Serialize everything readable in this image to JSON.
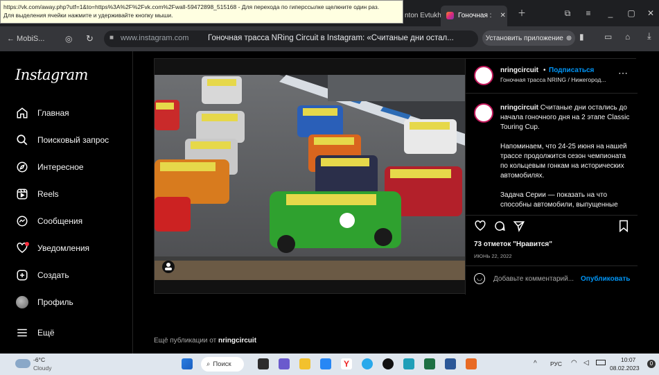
{
  "tooltip": {
    "line1": "https://vk.com/away.php?utf=1&to=https%3A%2F%2Fvk.com%2Fwall-59472898_515168 - Для перехода по гиперссылке щелкните один раз.",
    "line2": "Для выделения ячейки нажмите и удерживайте кнопку мыши."
  },
  "tabs": {
    "partial_tab": "nton Evtukh",
    "active_tab": "Гоночная :"
  },
  "address_bar": {
    "back_label": "← MobiS...",
    "url": "www.instagram.com",
    "page_title": "Гоночная трасса NRing Circuit в Instagram: «Считаные дни остал...",
    "install_label": "Установить приложение"
  },
  "sidebar": {
    "logo": "Instagram",
    "items": [
      {
        "label": "Главная",
        "icon": "home-icon"
      },
      {
        "label": "Поисковый запрос",
        "icon": "search-icon"
      },
      {
        "label": "Интересное",
        "icon": "compass-icon"
      },
      {
        "label": "Reels",
        "icon": "reels-icon"
      },
      {
        "label": "Сообщения",
        "icon": "messenger-icon"
      },
      {
        "label": "Уведомления",
        "icon": "heart-icon"
      },
      {
        "label": "Создать",
        "icon": "plus-square-icon"
      },
      {
        "label": "Профиль",
        "icon": "avatar-icon"
      }
    ],
    "more_label": "Ещё"
  },
  "post": {
    "username": "nringcircuit",
    "separator": "•",
    "follow_label": "Подписаться",
    "location": "Гоночная трасса NRING / Нижегород...",
    "caption_username": "nringcircuit",
    "caption_p1": "Считаные дни остались до начала гоночного дня на 2 этапе Classic Touring Cup.",
    "caption_p2": "Напоминаем, что 24-25 июня на нашей трассе продолжится сезон чемпионата по кольцевым гонкам на исторических автомобилях.",
    "caption_p3": "Задача Серии — показать на что способны автомобили, выпущенные",
    "likes": "73 отметок \"Нравится\"",
    "date": "ИЮНЬ 22, 2022",
    "comment_placeholder": "Добавьте комментарий...",
    "publish_label": "Опубликовать"
  },
  "more_from": {
    "prefix": "Ещё публикации от",
    "username": "nringcircuit"
  },
  "taskbar": {
    "temp": "-6°C",
    "weather": "Cloudy",
    "search_label": "Поиск",
    "lang": "РУС",
    "time": "10:07",
    "date": "08.02.2023"
  },
  "colors": {
    "accent_blue": "#0095f6",
    "notification_red": "#ff3040"
  }
}
